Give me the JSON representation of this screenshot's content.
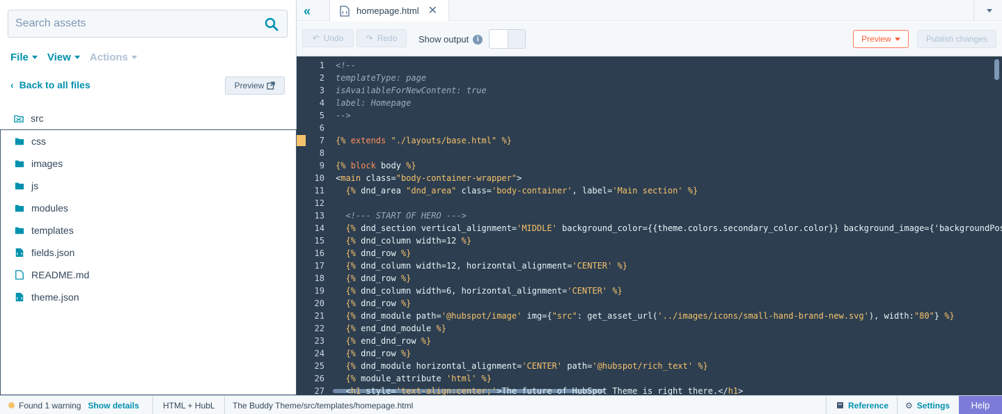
{
  "sidebar": {
    "search_placeholder": "Search assets",
    "menus": [
      {
        "label": "File",
        "enabled": true
      },
      {
        "label": "View",
        "enabled": true
      },
      {
        "label": "Actions",
        "enabled": false
      }
    ],
    "back_label": "Back to all files",
    "preview_label": "Preview",
    "root": {
      "name": "src",
      "icon": "theme-folder-icon"
    },
    "items": [
      {
        "name": "css",
        "icon": "folder-icon"
      },
      {
        "name": "images",
        "icon": "folder-icon"
      },
      {
        "name": "js",
        "icon": "folder-icon"
      },
      {
        "name": "modules",
        "icon": "folder-icon"
      },
      {
        "name": "templates",
        "icon": "folder-icon"
      },
      {
        "name": "fields.json",
        "icon": "json-file-icon"
      },
      {
        "name": "README.md",
        "icon": "file-icon"
      },
      {
        "name": "theme.json",
        "icon": "json-file-icon"
      }
    ]
  },
  "editor": {
    "tab_name": "homepage.html",
    "toolbar": {
      "undo_label": "Undo",
      "redo_label": "Redo",
      "show_output_label": "Show output",
      "preview_label": "Preview",
      "publish_label": "Publish changes"
    },
    "code_lines": [
      {
        "n": "1",
        "t": "comment",
        "text": "<!--"
      },
      {
        "n": "2",
        "t": "comment",
        "text": "templateType: page"
      },
      {
        "n": "3",
        "t": "comment",
        "text": "isAvailableForNewContent: true"
      },
      {
        "n": "4",
        "t": "comment",
        "text": "label: Homepage"
      },
      {
        "n": "5",
        "t": "comment",
        "text": "-->"
      },
      {
        "n": "6",
        "t": "plain",
        "text": ""
      },
      {
        "n": "7",
        "t": "hubl",
        "text": "{% extends \"./layouts/base.html\" %}",
        "marker": true
      },
      {
        "n": "8",
        "t": "plain",
        "text": ""
      },
      {
        "n": "9",
        "t": "hubl",
        "text": "{% block body %}"
      },
      {
        "n": "10",
        "t": "html",
        "text": "<main class=\"body-container-wrapper\">"
      },
      {
        "n": "11",
        "t": "hubl",
        "text": "  {% dnd_area \"dnd_area\" class='body-container', label='Main section' %}"
      },
      {
        "n": "12",
        "t": "plain",
        "text": ""
      },
      {
        "n": "13",
        "t": "comment",
        "text": "  <!--- START OF HERO --->"
      },
      {
        "n": "14",
        "t": "hubl",
        "text": "  {% dnd_section vertical_alignment='MIDDLE' background_color={{theme.colors.secondary_color.color}} background_image={'backgroundPos"
      },
      {
        "n": "15",
        "t": "hubl",
        "text": "  {% dnd_column width=12 %}"
      },
      {
        "n": "16",
        "t": "hubl",
        "text": "  {% dnd_row %}"
      },
      {
        "n": "17",
        "t": "hubl",
        "text": "  {% dnd_column width=12, horizontal_alignment='CENTER' %}"
      },
      {
        "n": "18",
        "t": "hubl",
        "text": "  {% dnd_row %}"
      },
      {
        "n": "19",
        "t": "hubl",
        "text": "  {% dnd_column width=6, horizontal_alignment='CENTER' %}"
      },
      {
        "n": "20",
        "t": "hubl",
        "text": "  {% dnd_row %}"
      },
      {
        "n": "21",
        "t": "hubl",
        "text": "  {% dnd_module path='@hubspot/image' img={\"src\": get_asset_url('../images/icons/small-hand-brand-new.svg'), width:\"80\"} %}"
      },
      {
        "n": "22",
        "t": "hubl",
        "text": "  {% end_dnd_module %}"
      },
      {
        "n": "23",
        "t": "hubl",
        "text": "  {% end_dnd_row %}"
      },
      {
        "n": "24",
        "t": "hubl",
        "text": "  {% dnd_row %}"
      },
      {
        "n": "25",
        "t": "hubl",
        "text": "  {% dnd_module horizontal_alignment='CENTER' path='@hubspot/rich_text' %}"
      },
      {
        "n": "26",
        "t": "hubl",
        "text": "  {% module_attribute 'html' %}"
      },
      {
        "n": "27",
        "t": "html",
        "text": "  <h1 style='text-align:center;'>The future of HubSpot Theme is right there.</h1>"
      }
    ]
  },
  "status": {
    "warning_text": "Found 1 warning",
    "show_details": "Show details",
    "language": "HTML + HubL",
    "path": "The Buddy Theme/src/templates/homepage.html",
    "reference": "Reference",
    "settings": "Settings",
    "help": "Help"
  },
  "colors": {
    "accent": "#0091ae",
    "editor_bg": "#2d3e50",
    "preview_orange": "#ff7a59",
    "help_purple": "#7c7cd8",
    "warning": "#f5c26b"
  }
}
